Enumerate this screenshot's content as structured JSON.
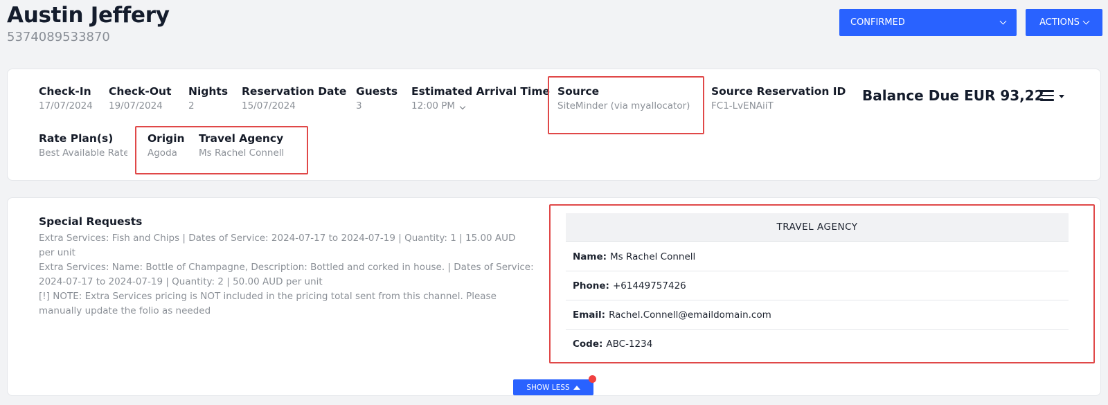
{
  "header": {
    "guest_name": "Austin Jeffery",
    "reservation_number": "5374089533870",
    "status_dropdown": "CONFIRMED",
    "actions_label": "ACTIONS"
  },
  "reservation": {
    "check_in": {
      "label": "Check-In",
      "value": "17/07/2024"
    },
    "check_out": {
      "label": "Check-Out",
      "value": "19/07/2024"
    },
    "nights": {
      "label": "Nights",
      "value": "2"
    },
    "reservation_date": {
      "label": "Reservation Date",
      "value": "15/07/2024"
    },
    "guests": {
      "label": "Guests",
      "value": "3"
    },
    "arrival_time": {
      "label": "Estimated Arrival Time",
      "value": "12:00 PM"
    },
    "source": {
      "label": "Source",
      "value": "SiteMinder (via myallocator)"
    },
    "source_reservation_id": {
      "label": "Source Reservation ID",
      "value": "FC1-LvENAiiT"
    },
    "rate_plans": {
      "label": "Rate Plan(s)",
      "value": "Best Available Rate"
    },
    "origin": {
      "label": "Origin",
      "value": "Agoda"
    },
    "travel_agency": {
      "label": "Travel Agency",
      "value": "Ms Rachel Connell"
    },
    "balance_due": "Balance Due EUR 93,22"
  },
  "special_requests": {
    "title": "Special Requests",
    "lines": [
      "Extra Services: Fish and Chips | Dates of Service: 2024-07-17 to 2024-07-19 | Quantity: 1 | 15.00 AUD per unit",
      "Extra Services: Name: Bottle of Champagne, Description: Bottled and corked in house. | Dates of Service: 2024-07-17 to 2024-07-19 | Quantity: 2 | 50.00 AUD per unit",
      "[!] NOTE: Extra Services pricing is NOT included in the pricing total sent from this channel. Please manually update the folio as needed"
    ]
  },
  "travel_agency_panel": {
    "title": "TRAVEL AGENCY",
    "name_label": "Name:",
    "name": "Ms Rachel Connell",
    "phone_label": "Phone:",
    "phone": "+61449757426",
    "email_label": "Email:",
    "email": "Rachel.Connell@emaildomain.com",
    "code_label": "Code:",
    "code": "ABC-1234"
  },
  "show_less_label": "SHOW LESS",
  "colors": {
    "accent": "#2962ff",
    "highlight": "#e04848",
    "notification": "#f04040"
  }
}
